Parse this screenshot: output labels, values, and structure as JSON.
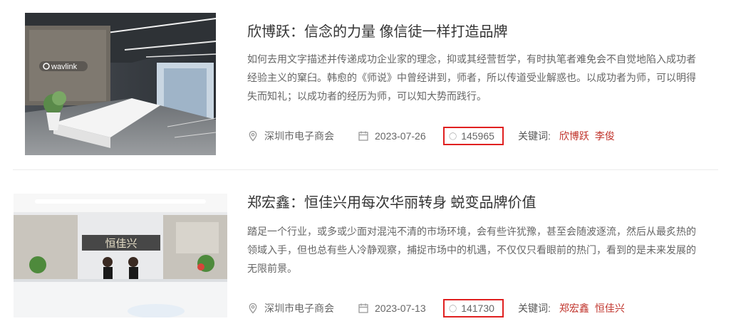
{
  "articles": [
    {
      "title": "欣博跃：信念的力量 像信徒一样打造品牌",
      "summary": "如何去用文字描述并传递成功企业家的理念，抑或其经营哲学，有时执笔者难免会不自觉地陷入成功者经验主义的窠臼。韩愈的《师说》中曾经讲到，师者，所以传道受业解惑也。以成功者为师，可以明得失而知礼；以成功者的经历为师，可以知大势而践行。",
      "image_logo": "wavlink",
      "source": "深圳市电子商会",
      "date": "2023-07-26",
      "views": "145965",
      "keywords_label": "关键词:",
      "keywords": [
        "欣博跃",
        "李俊"
      ]
    },
    {
      "title": "郑宏鑫：恒佳兴用每次华丽转身 蜕变品牌价值",
      "summary": "踏足一个行业，或多或少面对混沌不清的市场环境，会有些许犹豫，甚至会随波逐流，然后从最炙热的领域入手，但也总有些人冷静观察，捕捉市场中的机遇，不仅仅只看眼前的热门，看到的是未来发展的无限前景。",
      "image_logo": "恒佳兴",
      "source": "深圳市电子商会",
      "date": "2023-07-13",
      "views": "141730",
      "keywords_label": "关键词:",
      "keywords": [
        "郑宏鑫",
        "恒佳兴"
      ]
    }
  ],
  "icons": {
    "source": "location-pin-icon",
    "date": "calendar-icon",
    "views": "eye-icon"
  },
  "colors": {
    "keyword": "#c0332b",
    "highlight_border": "#e02020"
  }
}
